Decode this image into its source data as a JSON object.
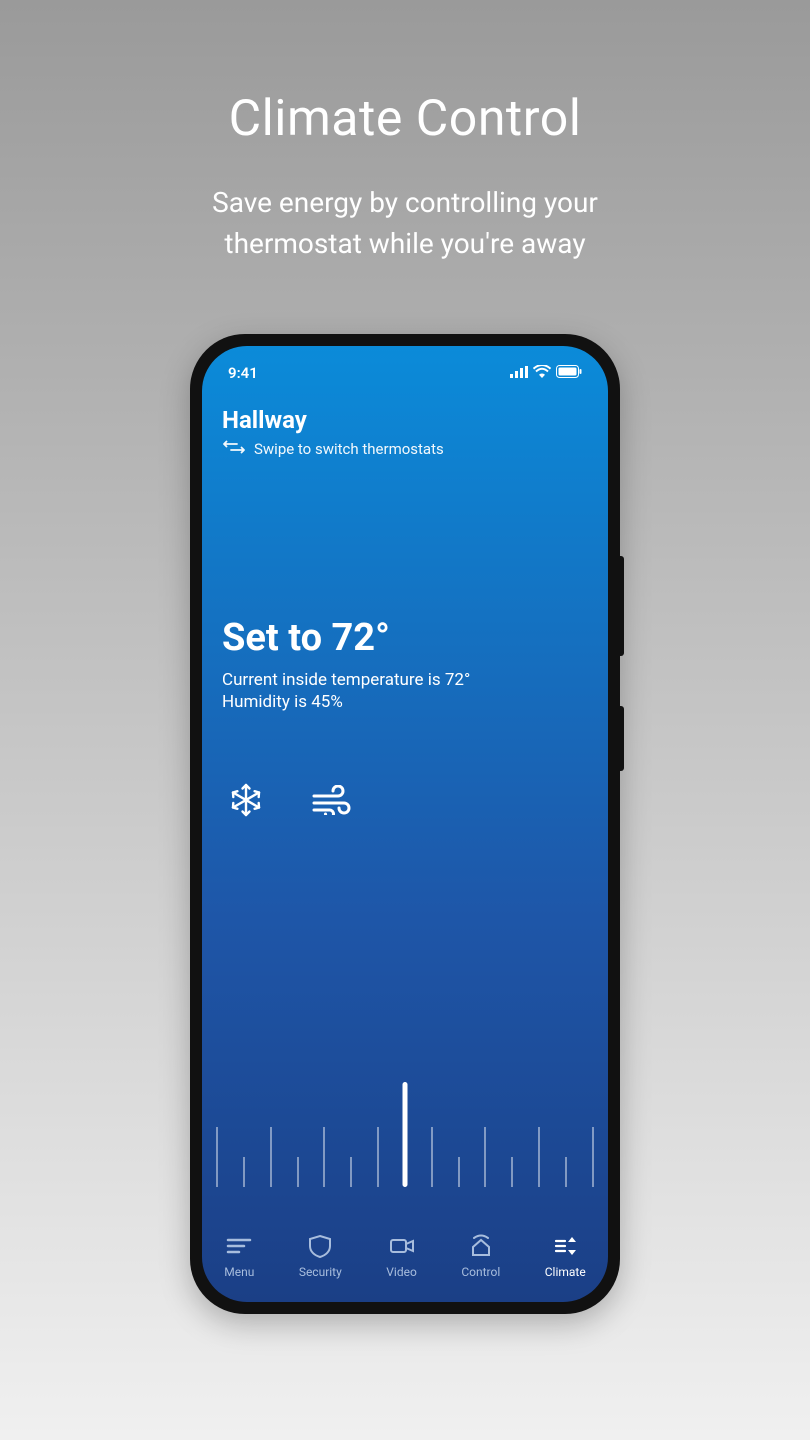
{
  "promo": {
    "title": "Climate Control",
    "subtitle": "Save energy by controlling your thermostat while you're away"
  },
  "status": {
    "time": "9:41"
  },
  "header": {
    "location": "Hallway",
    "swipe_hint": "Swipe to switch thermostats"
  },
  "climate": {
    "set_label": "Set to 72°",
    "current_label": "Current inside temperature is 72°",
    "humidity_label": "Humidity is 45%"
  },
  "tabs": {
    "menu": "Menu",
    "security": "Security",
    "video": "Video",
    "control": "Control",
    "climate": "Climate"
  }
}
